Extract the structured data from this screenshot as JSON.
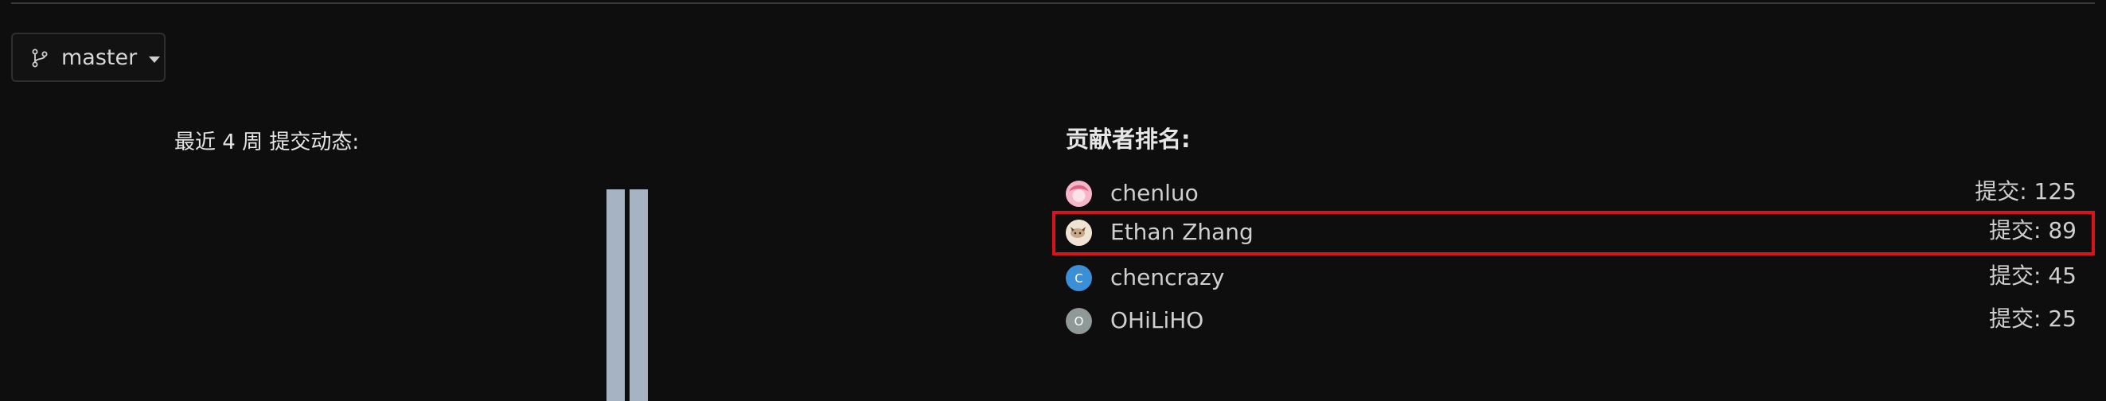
{
  "branch": {
    "icon": "git-branch-icon",
    "label": "master",
    "caret_icon": "caret-down-icon"
  },
  "activity": {
    "title": "最近 4 周 提交动态:"
  },
  "ranking": {
    "title": "贡献者排名:",
    "contributors": [
      {
        "name": "chenluo",
        "count": "提交: 125",
        "avatar": "pink-anime-avatar",
        "avatar_color": "#e88aa8"
      },
      {
        "name": "Ethan Zhang",
        "count": "提交: 89",
        "avatar": "cat-photo-avatar",
        "avatar_color": "#e9d9c6"
      },
      {
        "name": "chencrazy",
        "count": "提交: 45",
        "avatar_letter": "C",
        "avatar_color": "#3b8fd6"
      },
      {
        "name": "OHiLiHO",
        "count": "提交: 25",
        "avatar_letter": "O",
        "avatar_color": "#8f9a98"
      }
    ]
  },
  "highlight_color": "#d8141a"
}
